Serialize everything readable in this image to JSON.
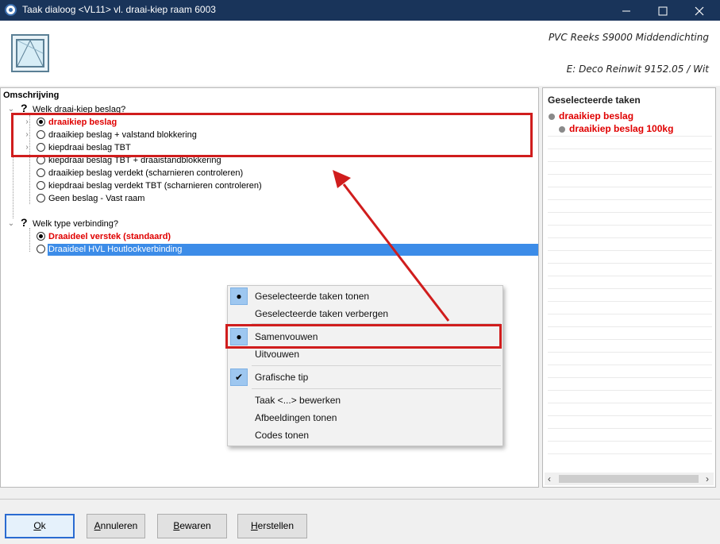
{
  "window": {
    "title": "Taak dialoog <VL11> vl. draai-kiep raam 6003",
    "minimize_icon": "minimize-icon",
    "maximize_icon": "maximize-icon",
    "close_icon": "close-icon"
  },
  "header": {
    "line1": "PVC Reeks S9000 Middendichting",
    "line2": "E: Deco Reinwit 9152.05 / Wit"
  },
  "left_panel": {
    "label": "Omschrijving",
    "question1": "Welk draai-kiep beslag?",
    "options1": [
      "draaikiep beslag",
      "draaikiep beslag + valstand blokkering",
      "kiepdraai beslag TBT",
      "kiepdraai beslag TBT + draaistandblokkering",
      "draaikiep beslag verdekt (scharnieren controleren)",
      "kiepdraai beslag verdekt TBT (scharnieren controleren)",
      "Geen beslag - Vast raam"
    ],
    "question2": "Welk type verbinding?",
    "options2": [
      "Draaideel verstek (standaard)",
      "Draaideel  HVL Houtlookverbinding"
    ]
  },
  "right_panel": {
    "title": "Geselecteerde taken",
    "item1": "draaikiep beslag",
    "item2": "draaikiep beslag 100kg"
  },
  "context_menu": {
    "show_selected": "Geselecteerde taken tonen",
    "hide_selected": "Geselecteerde taken verbergen",
    "collapse": "Samenvouwen",
    "expand": "Uitvouwen",
    "graphic_tip": "Grafische tip",
    "edit_task": "Taak <...> bewerken",
    "show_images": "Afbeeldingen tonen",
    "show_codes": "Codes tonen"
  },
  "buttons": {
    "ok_prefix": "O",
    "ok_suffix": "k",
    "cancel_prefix": "A",
    "cancel_suffix": "nnuleren",
    "save_prefix": "B",
    "save_suffix": "ewaren",
    "restore_prefix": "H",
    "restore_suffix": "erstellen"
  },
  "colors": {
    "titlebar": "#19345a",
    "selected_red": "#e00000",
    "annotation_red": "#d01d1d",
    "highlight_blue": "#3c8ce8"
  }
}
